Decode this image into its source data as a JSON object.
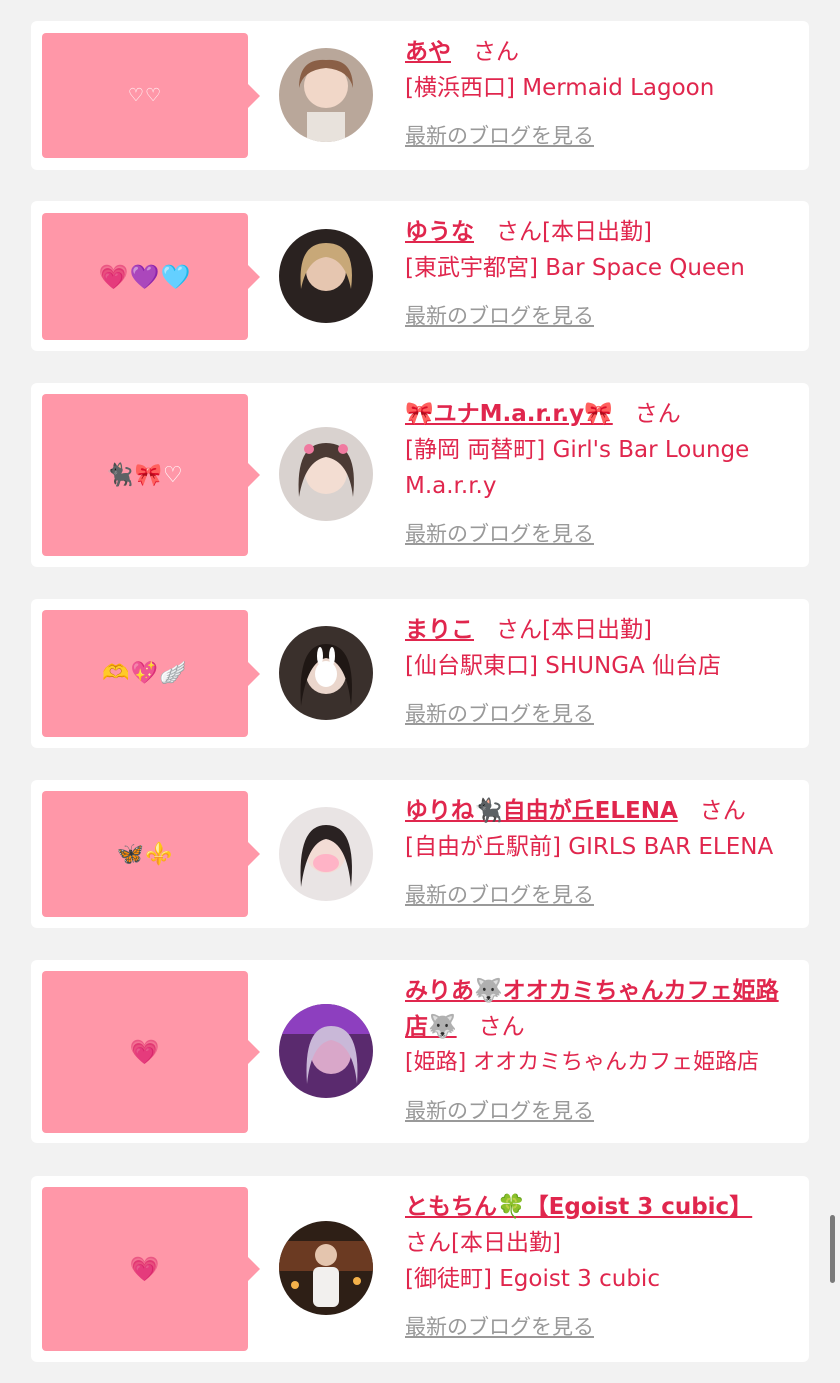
{
  "cards": [
    {
      "bubble": "♡♡",
      "name": "あや",
      "san": "さん",
      "status": "",
      "shop": "[横浜西口] Mermaid Lagoon",
      "blog": "最新のブログを見る"
    },
    {
      "bubble": "💗💜🩵",
      "name": "ゆうな",
      "san": "さん",
      "status": "[本日出勤]",
      "shop": "[東武宇都宮] Bar Space Queen",
      "blog": "最新のブログを見る"
    },
    {
      "bubble": "🐈‍⬛🎀♡",
      "name": "🎀ユナM.a.r.r.y🎀",
      "san": "さん",
      "status": "",
      "shop": "[静岡 両替町] Girl's Bar Lounge M.a.r.r.y",
      "blog": "最新のブログを見る"
    },
    {
      "bubble": "🫶💖🪽",
      "name": "まりこ",
      "san": "さん",
      "status": "[本日出勤]",
      "shop": "[仙台駅東口] SHUNGA 仙台店",
      "blog": "最新のブログを見る"
    },
    {
      "bubble": "🦋⚜️",
      "name": "ゆりね🐈‍⬛自由が丘ELENA",
      "san": "さん",
      "status": "",
      "shop": "[自由が丘駅前] GIRLS BAR ELENA",
      "blog": "最新のブログを見る"
    },
    {
      "bubble": "💗",
      "name": "みりあ🐺オオカミちゃんカフェ姫路店🐺",
      "san": "さん",
      "status": "",
      "shop": "[姫路] オオカミちゃんカフェ姫路店",
      "blog": "最新のブログを見る"
    },
    {
      "bubble": "💗",
      "name": "ともちん🍀【Egoist 3 cubic】",
      "san": "さん",
      "status": "[本日出勤]",
      "shop": "[御徒町] Egoist 3 cubic",
      "blog": "最新のブログを見る"
    }
  ],
  "colors": {
    "accent": "#e0264d",
    "bubble": "#ff97a8",
    "background": "#f2f2f2",
    "link_gray": "#999999"
  }
}
